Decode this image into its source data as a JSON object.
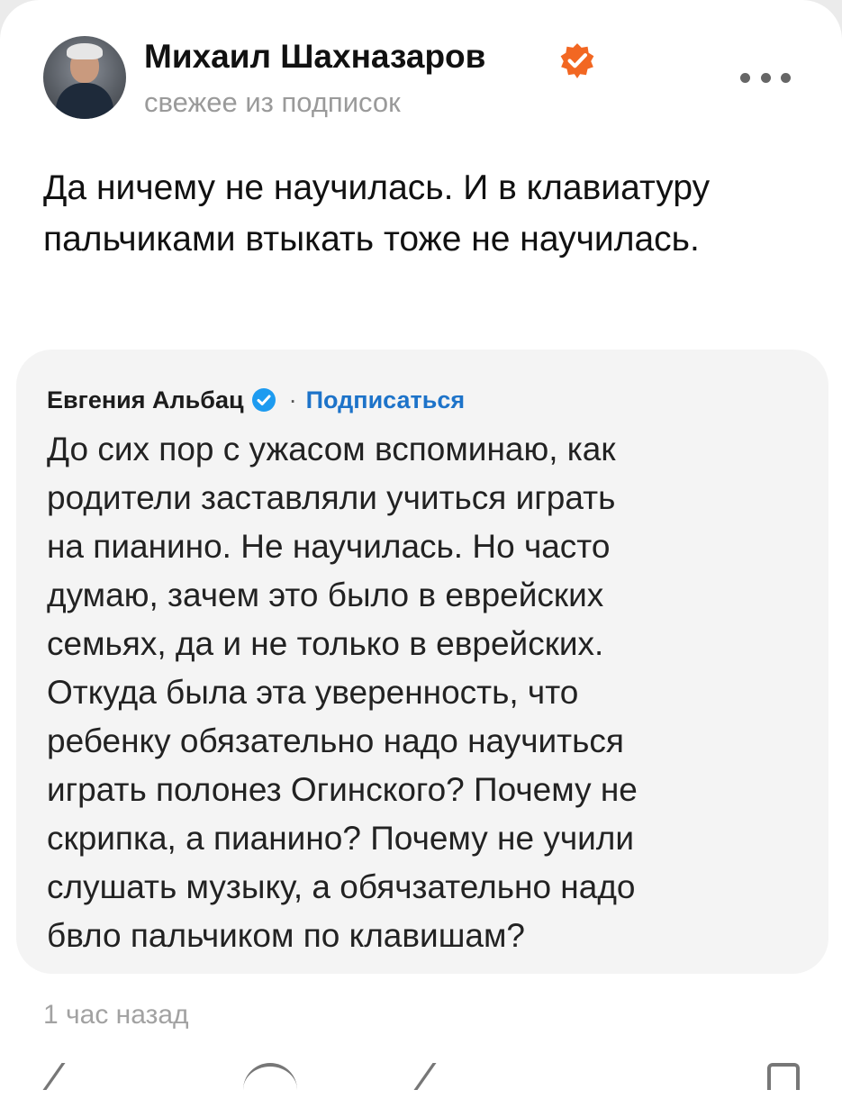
{
  "post": {
    "author_name": "Михаил Шахназаров",
    "subtitle": "свежее из подписок",
    "text": "Да ничему не научилась. И в клавиатуру пальчиками втыкать тоже не научилась.",
    "time": "1 час назад"
  },
  "quote": {
    "author_name": "Евгения Альбац",
    "separator": "·",
    "subscribe_label": "Подписаться",
    "text": "До сих пор с ужасом вспоминаю, как\nродители заставляли учиться играть\nна пианино. Не научилась. Но часто\nдумаю, зачем это было в еврейских\nсемьях, да и не только в еврейских.\nОткуда  была эта уверенность, что\nребенку обязательно надо научиться\nиграть полонез Огинского? Почему не\nскрипка, а пианино? Почему не учили\nслушать музыку, а обячзательно надо\nбвло пальчиком по клавишам?"
  },
  "icons": {
    "avatar": "avatar-photo",
    "author_badge": "verified-orange-icon",
    "quote_badge": "verified-blue-icon",
    "menu": "more-dots-icon"
  },
  "colors": {
    "author_badge": "#f26722",
    "quote_badge": "#1d9bf0",
    "subscribe_link": "#1d73c9",
    "muted_text": "#9a9a9a"
  }
}
